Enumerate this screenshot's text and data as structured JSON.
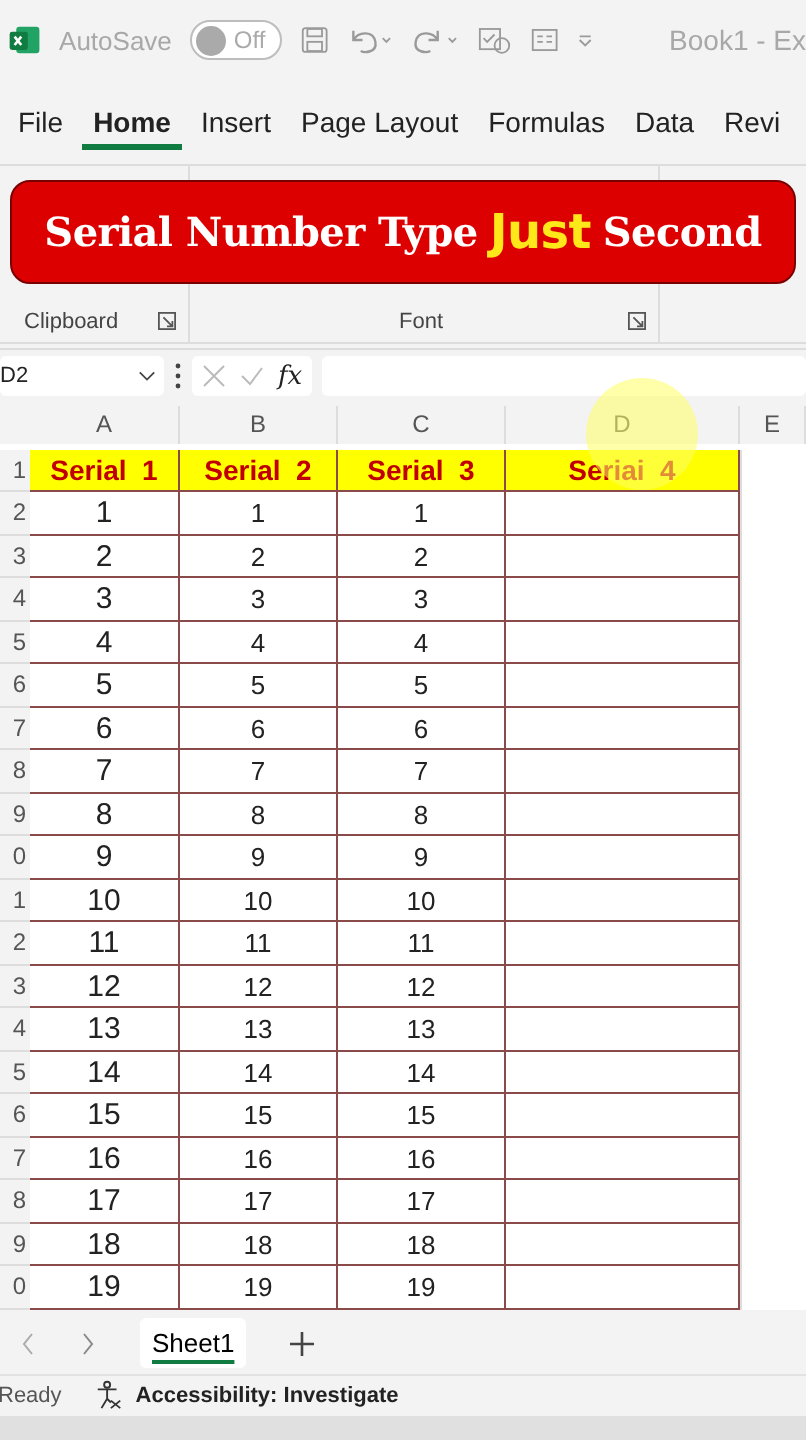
{
  "title_bar": {
    "autosave_label": "AutoSave",
    "autosave": {
      "label": "Off",
      "on": false
    },
    "document_title": "Book1 - Ex"
  },
  "ribbon_tabs": [
    {
      "label": "File",
      "selected": false
    },
    {
      "label": "Home",
      "selected": true
    },
    {
      "label": "Insert",
      "selected": false
    },
    {
      "label": "Page Layout",
      "selected": false
    },
    {
      "label": "Formulas",
      "selected": false
    },
    {
      "label": "Data",
      "selected": false
    },
    {
      "label": "Revi",
      "selected": false
    }
  ],
  "banner": {
    "text": "Serial Number Type **Just** Second"
  },
  "ribbon_groups": [
    {
      "label": "Clipboard"
    },
    {
      "label": "Font"
    }
  ],
  "formula_bar": {
    "name_box": "D2",
    "fx": "fx"
  },
  "sheet": {
    "columns": [
      "A",
      "B",
      "C",
      "D",
      "E"
    ],
    "header_row": {
      "row_number": "1",
      "cells": [
        "Serial  1",
        "Serial  2",
        "Serial  3",
        "Seriai  4"
      ]
    },
    "rows": [
      {
        "row_number": "2",
        "cells": [
          "1",
          "1",
          "1"
        ]
      },
      {
        "row_number": "3",
        "cells": [
          "2",
          "2",
          "2"
        ]
      },
      {
        "row_number": "4",
        "cells": [
          "3",
          "3",
          "3"
        ]
      },
      {
        "row_number": "5",
        "cells": [
          "4",
          "4",
          "4"
        ]
      },
      {
        "row_number": "6",
        "cells": [
          "5",
          "5",
          "5"
        ]
      },
      {
        "row_number": "7",
        "cells": [
          "6",
          "6",
          "6"
        ]
      },
      {
        "row_number": "8",
        "cells": [
          "7",
          "7",
          "7"
        ]
      },
      {
        "row_number": "9",
        "cells": [
          "8",
          "8",
          "8"
        ]
      },
      {
        "row_number": "0",
        "cells": [
          "9",
          "9",
          "9"
        ]
      },
      {
        "row_number": "1",
        "cells": [
          "10",
          "10",
          "10"
        ]
      },
      {
        "row_number": "2",
        "cells": [
          "11",
          "11",
          "11"
        ]
      },
      {
        "row_number": "3",
        "cells": [
          "12",
          "12",
          "12"
        ]
      },
      {
        "row_number": "4",
        "cells": [
          "13",
          "13",
          "13"
        ]
      },
      {
        "row_number": "5",
        "cells": [
          "14",
          "14",
          "14"
        ]
      },
      {
        "row_number": "6",
        "cells": [
          "15",
          "15",
          "15"
        ]
      },
      {
        "row_number": "7",
        "cells": [
          "16",
          "16",
          "16"
        ]
      },
      {
        "row_number": "8",
        "cells": [
          "17",
          "17",
          "17"
        ]
      },
      {
        "row_number": "9",
        "cells": [
          "18",
          "18",
          "18"
        ]
      },
      {
        "row_number": "0",
        "cells": [
          "19",
          "19",
          "19"
        ]
      }
    ]
  },
  "sheet_tabs": [
    {
      "label": "Sheet1",
      "selected": true
    }
  ],
  "status_bar": {
    "ready": "Ready",
    "accessibility": "Accessibility: Investigate"
  }
}
